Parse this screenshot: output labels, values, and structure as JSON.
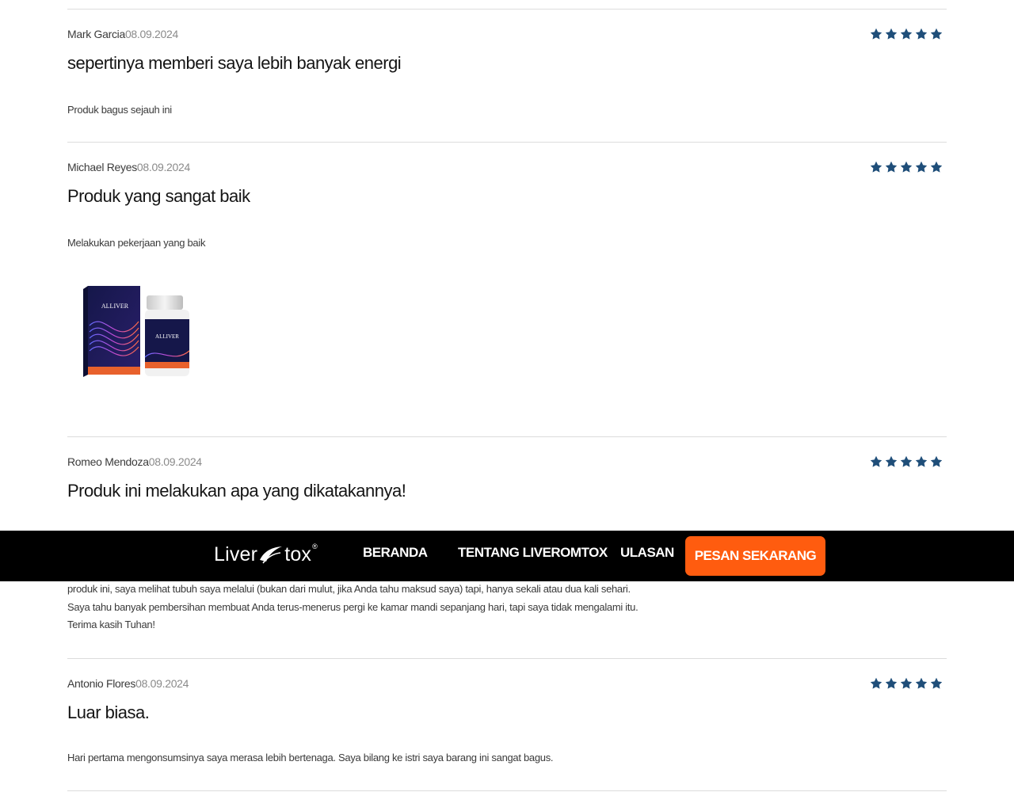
{
  "brand": {
    "logo_text_before": "Liver",
    "logo_text_after": "tox",
    "logo_reg": "®",
    "star_color": "#1f4e79",
    "cta_color": "#ff5c0f"
  },
  "nav": {
    "items": [
      "BERANDA",
      "TENTANG LIVEROMTOX",
      "ULASAN"
    ],
    "cta_label": "PESAN SEKARANG"
  },
  "reviews": [
    {
      "author": "Mark Garcia",
      "date": "08.09.2024",
      "rating": 5,
      "title": "sepertinya memberi saya lebih banyak energi",
      "body": [
        "Produk bagus sejauh ini"
      ]
    },
    {
      "author": "Michael Reyes",
      "date": "08.09.2024",
      "rating": 5,
      "title": "Produk yang sangat baik",
      "body": [
        "Melakukan pekerjaan yang baik"
      ],
      "image": {
        "name": "product-photo",
        "box_label": "ALLIVER",
        "bottle_label": "ALLIVER"
      }
    },
    {
      "author": "Romeo Mendoza",
      "date": "08.09.2024",
      "rating": 5,
      "title": "Produk ini melakukan apa yang dikatakannya!",
      "body": [
        "produk ini, saya melihat tubuh saya melalui (bukan dari mulut, jika Anda tahu maksud saya) tapi, hanya sekali atau dua kali sehari.",
        "Saya tahu banyak pembersihan membuat Anda terus-menerus pergi ke kamar mandi sepanjang hari, tapi saya tidak mengalami itu.",
        "Terima kasih Tuhan!"
      ]
    },
    {
      "author": "Antonio Flores",
      "date": "08.09.2024",
      "rating": 5,
      "title": "Luar biasa.",
      "body": [
        "Hari pertama mengonsumsinya saya merasa lebih bertenaga. Saya bilang ke istri saya barang ini sangat bagus."
      ]
    }
  ]
}
